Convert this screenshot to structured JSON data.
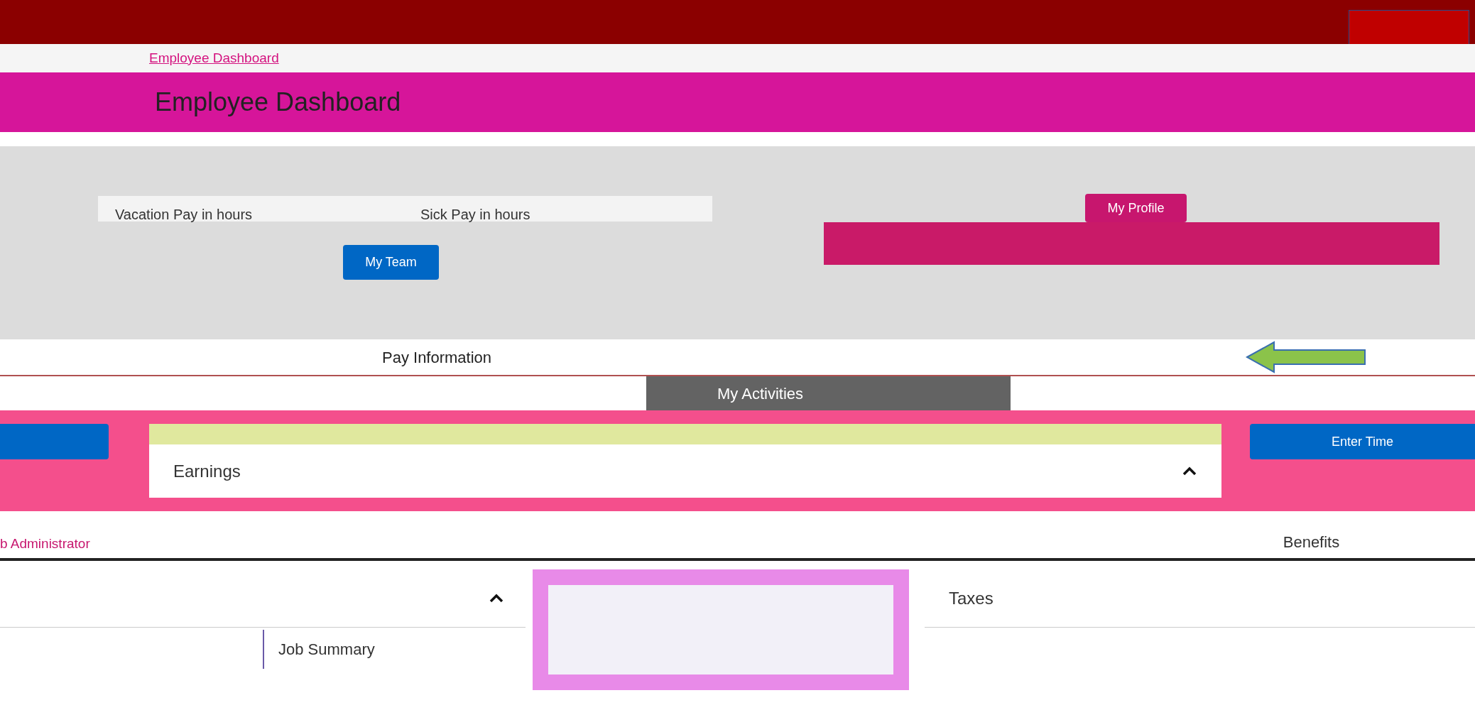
{
  "breadcrumb": "Employee Dashboard",
  "title": "Employee Dashboard",
  "balances": [
    {
      "label": "Vacation Pay in hours"
    },
    {
      "label": "Sick Pay in hours"
    }
  ],
  "buttons": {
    "profile": "My Profile",
    "team": "My Team",
    "enter_time": "Enter Time"
  },
  "pay_information": "Pay Information",
  "activities": "My Activities",
  "sections": [
    {
      "label": "Earnings",
      "expanded": true
    }
  ],
  "links": {
    "administrator": "b Administrator",
    "benefits": "Benefits"
  },
  "lower": [
    {
      "label": "Taxes"
    },
    {
      "label": "Job Summary"
    }
  ]
}
